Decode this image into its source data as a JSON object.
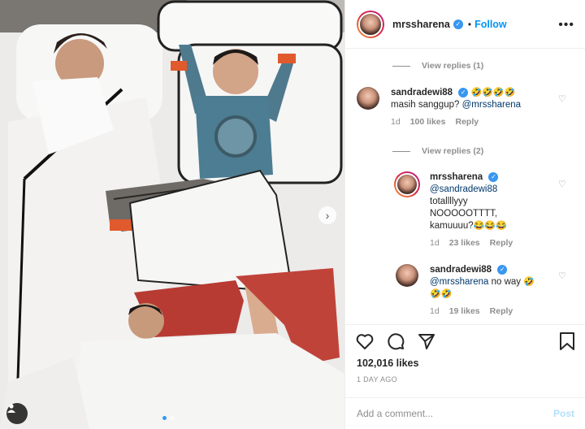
{
  "post": {
    "username": "mrssharena",
    "follow_label": "Follow",
    "separator": "•",
    "more_label": "•••"
  },
  "comments": {
    "view_replies_1": "View replies (1)",
    "c1": {
      "username": "sandradewi88",
      "emojis": "🤣🤣🤣🤣",
      "text": "masih sanggup?",
      "mention": "@mrssharena",
      "age": "1d",
      "likes": "100 likes",
      "reply": "Reply"
    },
    "view_replies_2": "View replies (2)",
    "r1": {
      "username": "mrssharena",
      "mention": "@sandradewi88",
      "line1": "totallllyyy",
      "line2": "NOOOOOTTTT,",
      "line3": "kamuuuu?",
      "emojis": "😂😂😂",
      "age": "1d",
      "likes": "23 likes",
      "reply": "Reply"
    },
    "r2": {
      "username": "sandradewi88",
      "mention": "@mrssharena",
      "text": "no way",
      "emoji1": "🤣",
      "emojis2": "🤣🤣",
      "age": "1d",
      "likes": "19 likes",
      "reply": "Reply"
    }
  },
  "actions": {
    "likes_count": "102,016 likes",
    "timestamp": "1 DAY AGO"
  },
  "add_comment": {
    "placeholder": "Add a comment...",
    "post_label": "Post"
  },
  "carousel": {
    "total_slides": 2,
    "active_slide": 1
  },
  "colors": {
    "accent": "#0095f6",
    "verified": "#3897f0",
    "muted": "#8e8e8e"
  }
}
